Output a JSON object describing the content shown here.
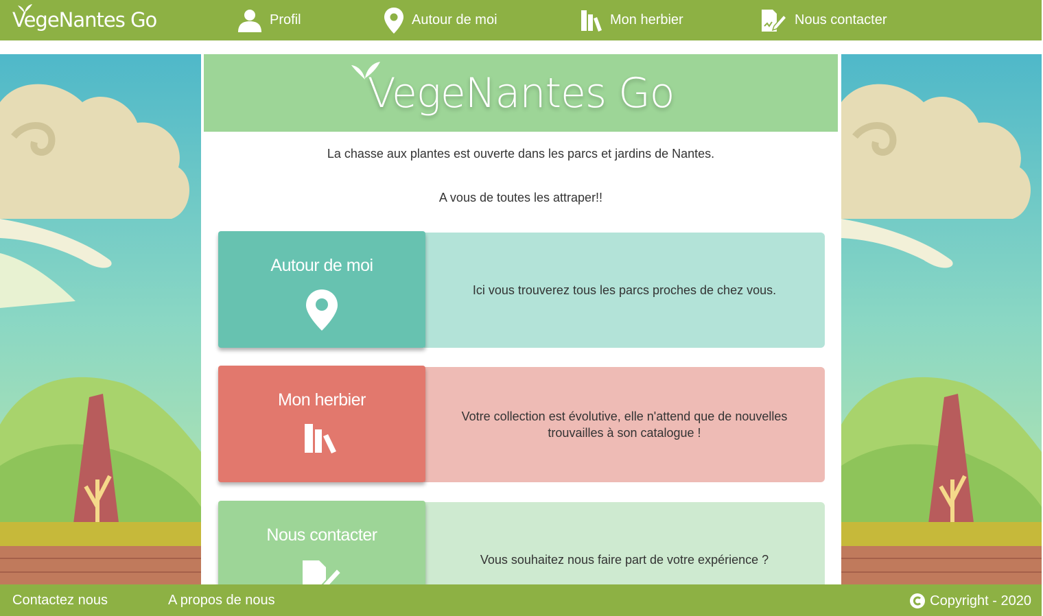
{
  "nav": {
    "brand": "VegeNantes Go",
    "items": [
      {
        "label": "Profil",
        "icon": "user-icon"
      },
      {
        "label": "Autour de moi",
        "icon": "map-pin-icon"
      },
      {
        "label": "Mon herbier",
        "icon": "books-icon"
      },
      {
        "label": "Nous contacter",
        "icon": "contact-form-icon"
      }
    ]
  },
  "banner": {
    "title": "VegeNantes Go"
  },
  "intro": {
    "line1": "La chasse aux plantes est ouverte dans les parcs et jardins de Nantes.",
    "line2": "A vous de toutes les attraper!!"
  },
  "features": [
    {
      "label": "Autour de moi",
      "icon": "map-pin-icon",
      "description": "Ici vous trouverez tous les parcs proches de chez vous.",
      "color": "#67c2b0",
      "desc_color": "#b3e3d8"
    },
    {
      "label": "Mon herbier",
      "icon": "books-icon",
      "description": "Votre collection est évolutive, elle n'attend que de nouvelles trouvailles à son catalogue !",
      "color": "#e2786d",
      "desc_color": "#eebbb5"
    },
    {
      "label": "Nous contacter",
      "icon": "contact-form-icon",
      "description": "Vous souhaitez nous faire part de votre expérience ?",
      "color": "#9dd597",
      "desc_color": "#ceead0"
    }
  ],
  "footer": {
    "contact": "Contactez nous",
    "about": "A propos de nous",
    "copyright": "Copyright - 2020"
  },
  "colors": {
    "nav": "#8db144",
    "banner": "#9dd597"
  }
}
